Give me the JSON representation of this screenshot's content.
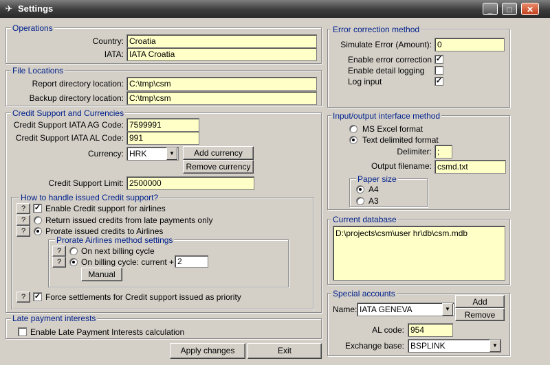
{
  "window": {
    "title": "Settings",
    "app_icon": "airplane-icon"
  },
  "operations": {
    "legend": "Operations",
    "country_label": "Country:",
    "country_value": "Croatia",
    "iata_label": "IATA:",
    "iata_value": "IATA Croatia"
  },
  "file_locations": {
    "legend": "File Locations",
    "report_label": "Report directory location:",
    "report_value": "C:\\tmp\\csm",
    "backup_label": "Backup directory location:",
    "backup_value": "C:\\tmp\\csm"
  },
  "credit": {
    "legend": "Credit Support and Currencies",
    "ag_label": "Credit Support IATA AG Code:",
    "ag_value": "7599991",
    "al_label": "Credit Support IATA AL Code:",
    "al_value": "991",
    "currency_label": "Currency:",
    "currency_value": "HRK",
    "add_currency": "Add currency",
    "remove_currency": "Remove currency",
    "limit_label": "Credit Support Limit:",
    "limit_value": "2500000"
  },
  "handling": {
    "legend": "How to handle issued Credit support?",
    "help": "?",
    "enable_label": "Enable Credit support for airlines",
    "return_label": "Return issued credits from late payments only",
    "prorate_label": "Prorate issued credits to Airlines",
    "prorate_legend": "Prorate Airlines method settings",
    "next_cycle_label": "On next billing cycle",
    "on_cycle_label": "On billing cycle: current +",
    "on_cycle_value": "2",
    "manual": "Manual",
    "force_label": "Force settlements for Credit support issued as priority"
  },
  "late": {
    "legend": "Late payment interests",
    "enable_label": "Enable Late Payment Interests calculation"
  },
  "actions": {
    "apply": "Apply changes",
    "exit": "Exit"
  },
  "error": {
    "legend": "Error correction method",
    "simulate_label": "Simulate Error (Amount):",
    "simulate_value": "0",
    "enable_label": "Enable error correction",
    "detail_label": "Enable detail logging",
    "log_label": "Log input"
  },
  "io": {
    "legend": "Input/output interface method",
    "excel_label": "MS Excel format",
    "text_label": "Text delimited format",
    "delimiter_label": "Delimiter:",
    "delimiter_value": ";",
    "filename_label": "Output filename:",
    "filename_value": "csmd.txt",
    "paper_legend": "Paper size",
    "a4": "A4",
    "a3": "A3"
  },
  "database": {
    "legend": "Current database",
    "path": "D:\\projects\\csm\\user hr\\db\\csm.mdb"
  },
  "special": {
    "legend": "Special accounts",
    "name_label": "Name:",
    "name_value": "IATA GENEVA",
    "add": "Add",
    "remove": "Remove",
    "al_label": "AL code:",
    "al_value": "954",
    "exchange_label": "Exchange base:",
    "exchange_value": "BSPLINK"
  }
}
